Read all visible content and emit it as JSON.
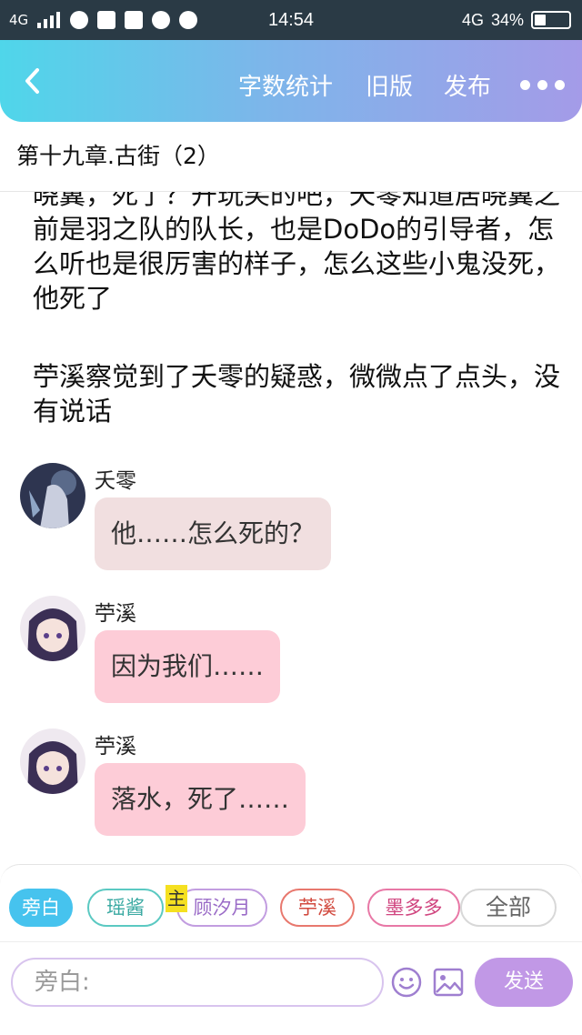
{
  "status_bar": {
    "network": "4G",
    "time": "14:54",
    "network_right": "4G",
    "battery_text": "34%",
    "battery_level": 0.34
  },
  "header": {
    "word_count": "字数统计",
    "old_version": "旧版",
    "publish": "发布"
  },
  "chapter": {
    "title": "第十九章.古街（2）"
  },
  "content": {
    "para1": "晓翼，死了？开玩笑的吧，夭零知道居晓翼之前是羽之队的队长，也是DoDo的引导者，怎么听也是很厉害的样子，怎么这些小鬼没死，他死了",
    "para2": "苧溪察觉到了夭零的疑惑，微微点了点头，没有说话"
  },
  "messages": [
    {
      "speaker": "夭零",
      "text": "他……怎么死的？",
      "style": "grey"
    },
    {
      "speaker": "苧溪",
      "text": "因为我们……",
      "style": "pink"
    },
    {
      "speaker": "苧溪",
      "text": "落水，死了……",
      "style": "pink"
    }
  ],
  "roles": {
    "narration": "旁白",
    "r1": "瑶酱",
    "main_tag": "主",
    "r2": "顾汐月",
    "r3": "苧溪",
    "r4": "墨多多",
    "all": "全部"
  },
  "input": {
    "placeholder": "旁白:",
    "send": "发送"
  },
  "colors": {
    "header_gradient_start": "#4fd6ea",
    "header_gradient_end": "#a49be8",
    "active_chip": "#46c3ee",
    "send_button": "#c198e6",
    "bubble_grey": "#f1dfe0",
    "bubble_pink": "#fdccd7"
  },
  "icons": [
    "back-arrow-icon",
    "more-dots-icon",
    "emoji-icon",
    "image-icon"
  ]
}
